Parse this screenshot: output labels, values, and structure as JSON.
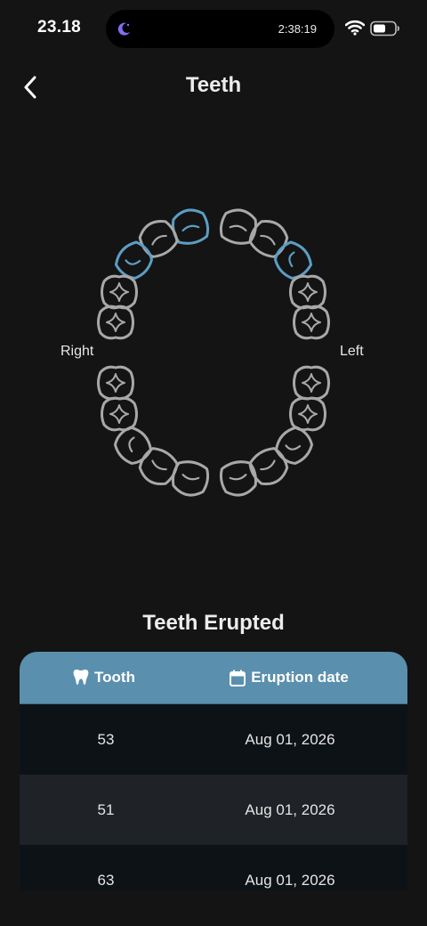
{
  "status_bar": {
    "time": "23.18",
    "island_timer": "2:38:19",
    "icons": [
      "moon-icon",
      "wifi-icon",
      "battery-icon"
    ]
  },
  "header": {
    "title": "Teeth",
    "back_icon": "chevron-left-icon"
  },
  "teeth_chart": {
    "right_label": "Right",
    "left_label": "Left",
    "highlight_color": "#5b9ec4",
    "default_color": "#a8a8a8"
  },
  "erupted": {
    "title": "Teeth Erupted",
    "columns": {
      "tooth": "Tooth",
      "date": "Eruption date"
    },
    "rows": [
      {
        "tooth": "53",
        "date": "Aug 01, 2026"
      },
      {
        "tooth": "51",
        "date": "Aug 01, 2026"
      },
      {
        "tooth": "63",
        "date": "Aug 01, 2026"
      }
    ],
    "header_color": "#5a8fae"
  }
}
